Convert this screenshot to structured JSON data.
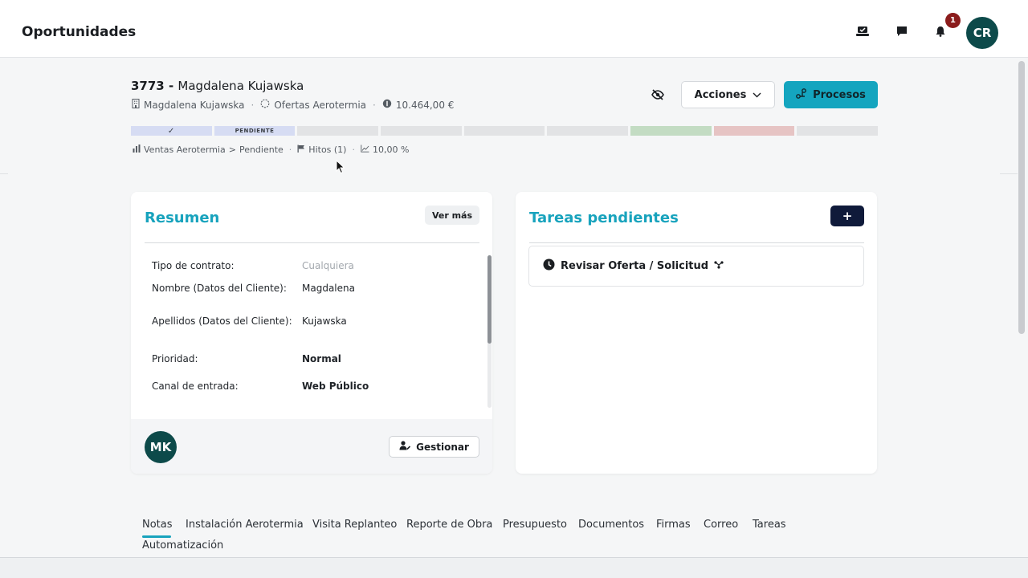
{
  "topbar": {
    "title": "Oportunidades",
    "notification_count": "1",
    "user_initials": "CR"
  },
  "record": {
    "number": "3773",
    "separator": " - ",
    "name": "Magdalena Kujawska",
    "company": "Magdalena Kujawska",
    "pipeline": "Ofertas Aerotermia",
    "amount": "10.464,00 €",
    "stage_current_label": "PENDIENTE",
    "stage_done_mark": "✓"
  },
  "actions": {
    "acciones_label": "Acciones",
    "procesos_label": "Procesos"
  },
  "breadcrumb": {
    "pipeline": "Ventas Aerotermia",
    "arrow": ">",
    "stage": "Pendiente",
    "hitos": "Hitos (1)",
    "probability": "10,00 %"
  },
  "resumen": {
    "title": "Resumen",
    "ver_mas_label": "Ver más",
    "fields": [
      {
        "label": "Tipo de contrato:",
        "value": "Cualquiera"
      },
      {
        "label": "Nombre (Datos del Cliente):",
        "value": "Magdalena"
      },
      {
        "label": "Apellidos (Datos del Cliente):",
        "value": "Kujawska"
      },
      {
        "label": "Prioridad:",
        "value": "Normal"
      },
      {
        "label": "Canal de entrada:",
        "value": "Web Público"
      }
    ],
    "owner_initials": "MK",
    "gestionar_label": "Gestionar"
  },
  "tareas": {
    "title": "Tareas pendientes",
    "add_label": "+",
    "items": [
      {
        "label": "Revisar Oferta / Solicitud"
      }
    ]
  },
  "tabs": [
    {
      "label": "Notas"
    },
    {
      "label": "Instalación Aerotermia"
    },
    {
      "label": "Visita Replanteo"
    },
    {
      "label": "Reporte de Obra"
    },
    {
      "label": "Presupuesto"
    },
    {
      "label": "Documentos"
    },
    {
      "label": "Firmas"
    },
    {
      "label": "Correo"
    },
    {
      "label": "Tareas"
    },
    {
      "label": "Automatización"
    }
  ],
  "colors": {
    "accent": "#18a3bd",
    "procesos_button": "#14a5bf",
    "avatar": "#0d4a4a",
    "badge": "#8b1c1c",
    "add_button": "#0f1a3a"
  }
}
